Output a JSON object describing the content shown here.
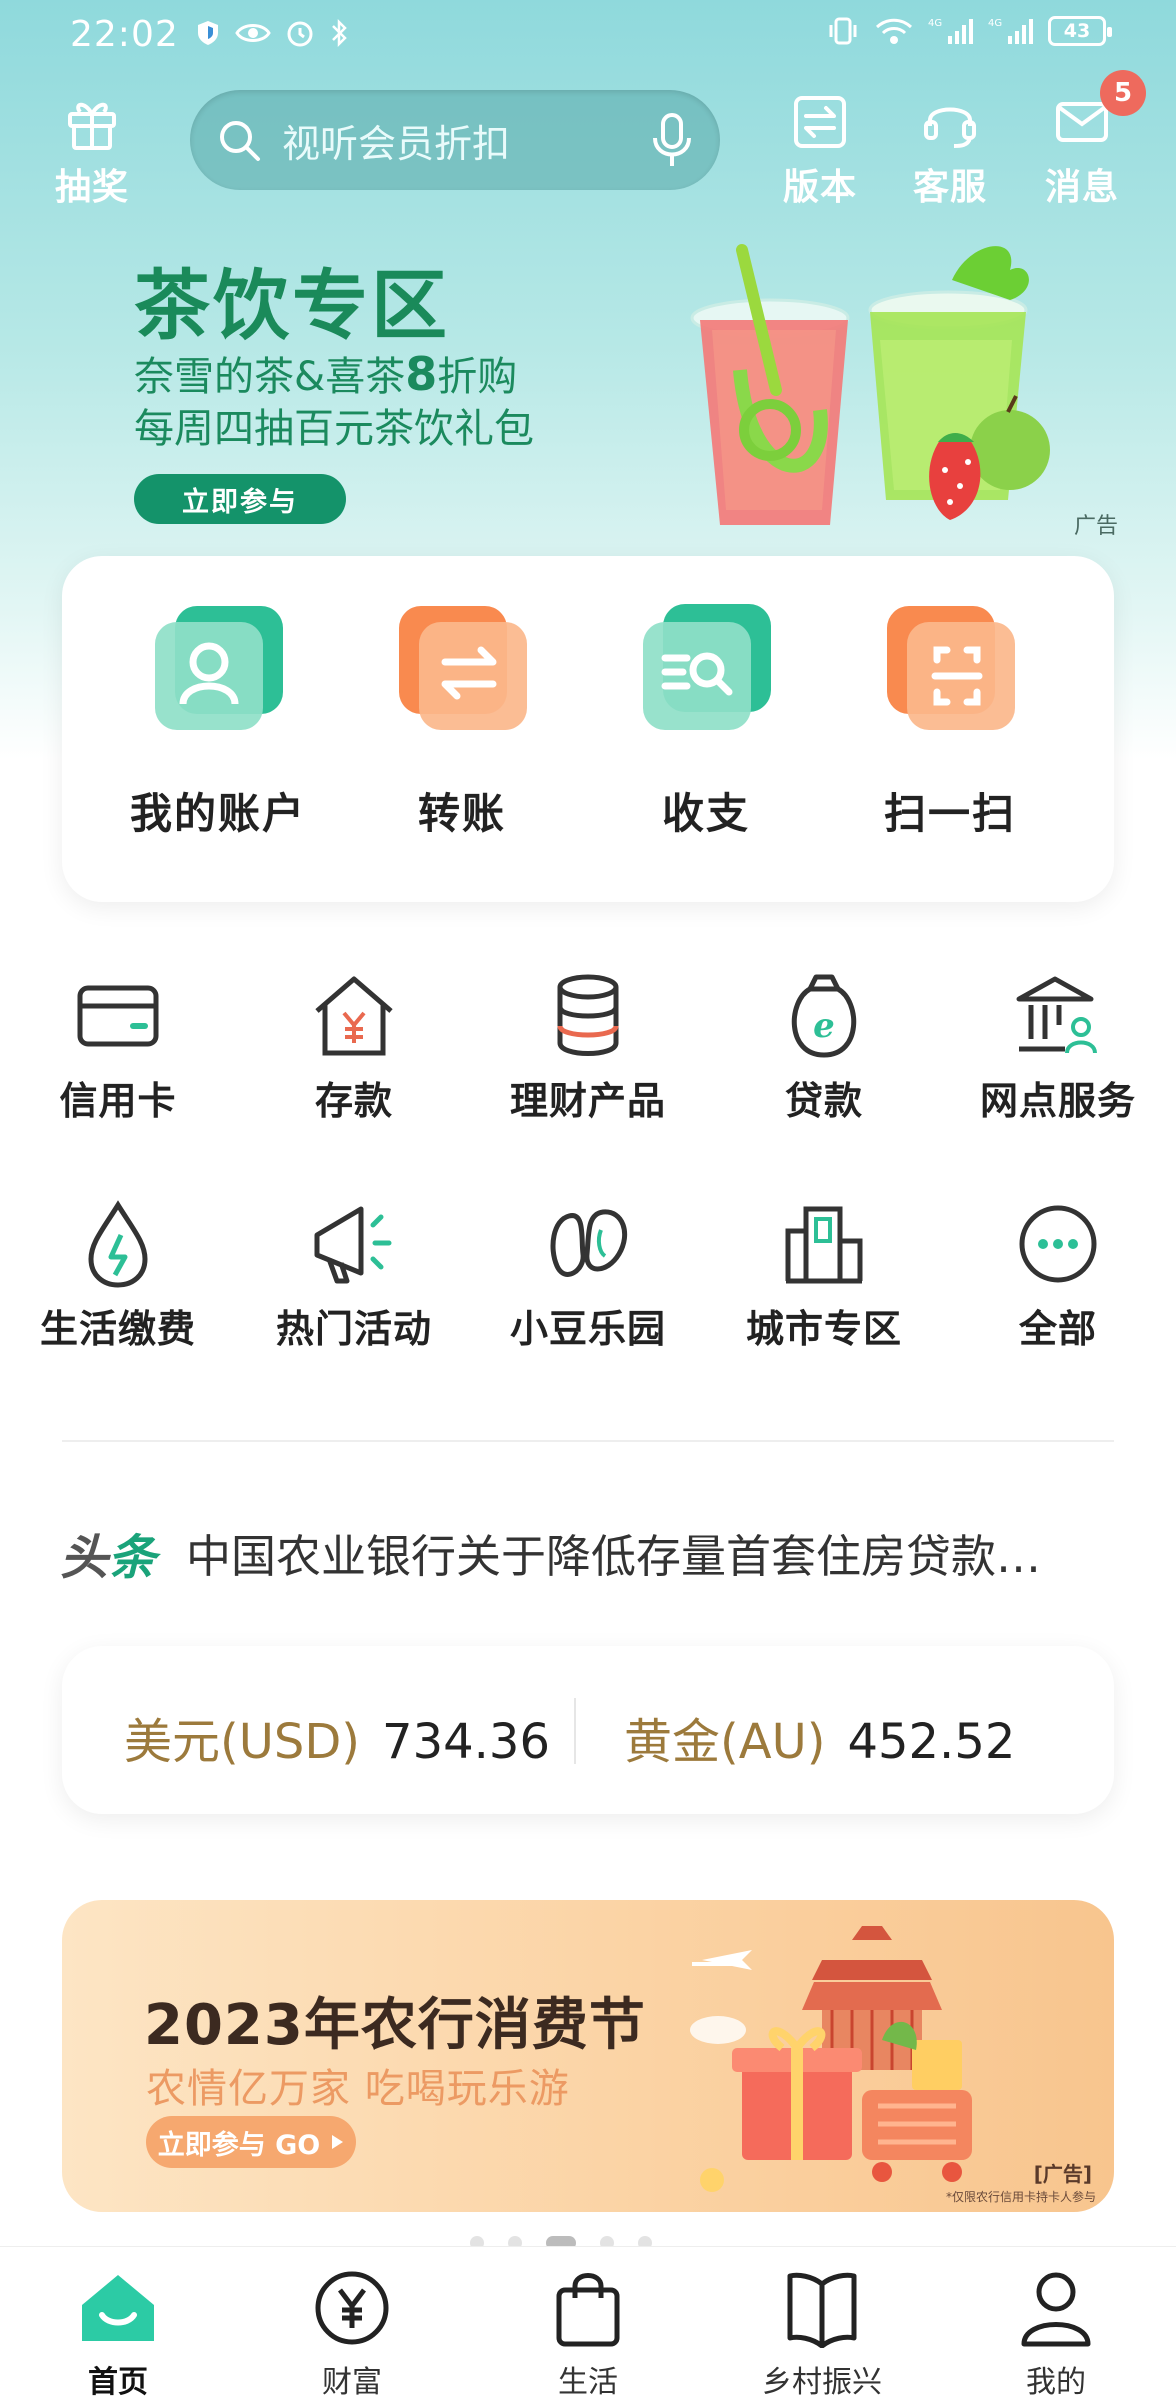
{
  "status_bar": {
    "time": "22:02",
    "network": "4G",
    "battery": "43"
  },
  "header": {
    "lottery_label": "抽奖",
    "search_placeholder": "视听会员折扣",
    "version_label": "版本",
    "service_label": "客服",
    "message_label": "消息",
    "message_badge": "5"
  },
  "banner": {
    "title": "茶饮专区",
    "line1_prefix": "奈雪的茶&喜茶",
    "line1_discount": "8",
    "line1_suffix": "折购",
    "line2": "每周四抽百元茶饮礼包",
    "button": "立即参与",
    "ad_tag": "广告"
  },
  "quick_actions": [
    {
      "label": "我的账户",
      "icon": "account-icon"
    },
    {
      "label": "转账",
      "icon": "transfer-icon"
    },
    {
      "label": "收支",
      "icon": "income-expense-icon"
    },
    {
      "label": "扫一扫",
      "icon": "scan-icon"
    }
  ],
  "services": [
    {
      "label": "信用卡",
      "icon": "credit-card-icon"
    },
    {
      "label": "存款",
      "icon": "deposit-icon"
    },
    {
      "label": "理财产品",
      "icon": "wealth-product-icon"
    },
    {
      "label": "贷款",
      "icon": "loan-icon"
    },
    {
      "label": "网点服务",
      "icon": "branch-service-icon"
    },
    {
      "label": "生活缴费",
      "icon": "utility-payment-icon"
    },
    {
      "label": "热门活动",
      "icon": "megaphone-icon"
    },
    {
      "label": "小豆乐园",
      "icon": "bean-icon"
    },
    {
      "label": "城市专区",
      "icon": "city-icon"
    },
    {
      "label": "全部",
      "icon": "more-icon"
    }
  ],
  "headline": {
    "tag_a": "头",
    "tag_b": "条",
    "text": "中国农业银行关于降低存量首套住房贷款…"
  },
  "rates": {
    "usd_label": "美元(USD)",
    "usd_value": "734.36",
    "gold_label": "黄金(AU)",
    "gold_value": "452.52"
  },
  "promo": {
    "title": "2023年农行消费节",
    "subtitle": "农情亿万家 吃喝玩乐游",
    "button": "立即参与 GO",
    "ad_tag": "[广告]",
    "note": "*仅限农行信用卡持卡人参与"
  },
  "carousel": {
    "count": 5,
    "active": 2
  },
  "tabbar": [
    {
      "label": "首页",
      "icon": "home-icon",
      "active": true
    },
    {
      "label": "财富",
      "icon": "yen-icon",
      "active": false
    },
    {
      "label": "生活",
      "icon": "shopping-bag-icon",
      "active": false
    },
    {
      "label": "乡村振兴",
      "icon": "book-icon",
      "active": false
    },
    {
      "label": "我的",
      "icon": "profile-icon",
      "active": false
    }
  ],
  "colors": {
    "brand_green": "#14936a",
    "accent_orange": "#f6a86f",
    "gold_text": "#9c7a3c",
    "badge_red": "#ee6a5d"
  }
}
